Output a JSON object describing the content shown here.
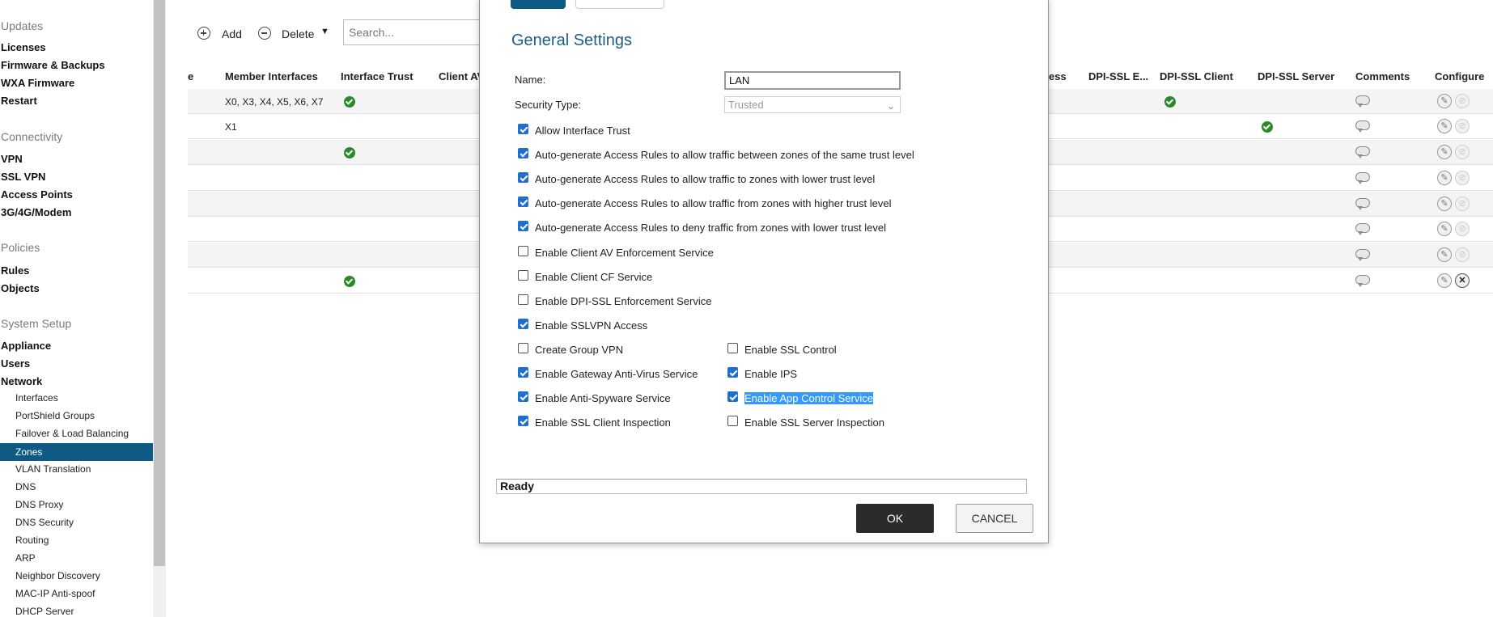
{
  "sidebar": {
    "sections": [
      {
        "heading": "Updates",
        "items": [
          "Licenses",
          "Firmware & Backups",
          "WXA Firmware",
          "Restart"
        ]
      },
      {
        "heading": "Connectivity",
        "items": [
          "VPN",
          "SSL VPN",
          "Access Points",
          "3G/4G/Modem"
        ]
      },
      {
        "heading": "Policies",
        "items": [
          "Rules",
          "Objects"
        ]
      },
      {
        "heading": "System Setup",
        "items": [
          "Appliance",
          "Users",
          "Network"
        ]
      }
    ],
    "network_subitems": [
      "Interfaces",
      "PortShield Groups",
      "Failover & Load Balancing",
      "Zones",
      "VLAN Translation",
      "DNS",
      "DNS Proxy",
      "DNS Security",
      "Routing",
      "ARP",
      "Neighbor Discovery",
      "MAC-IP Anti-spoof",
      "DHCP Server"
    ],
    "active_subitem": "Zones"
  },
  "toolbar": {
    "add_label": "Add",
    "delete_label": "Delete",
    "search_placeholder": "Search..."
  },
  "table": {
    "headers": {
      "name_partial": "e",
      "member_interfaces": "Member Interfaces",
      "interface_trust": "Interface Trust",
      "client_av": "Client AV",
      "ess_partial": "ess",
      "dpi_ssl_e": "DPI-SSL E...",
      "dpi_ssl_client": "DPI-SSL Client",
      "dpi_ssl_server": "DPI-SSL Server",
      "comments": "Comments",
      "configure": "Configure"
    },
    "rows": [
      {
        "members": "X0, X3, X4, X5, X6, X7",
        "trust": true,
        "dpi_client": true,
        "dpi_server": false,
        "deletable": false
      },
      {
        "members": "X1",
        "trust": false,
        "dpi_client": false,
        "dpi_server": true,
        "deletable": false
      },
      {
        "members": "",
        "trust": true,
        "dpi_client": false,
        "dpi_server": false,
        "deletable": false
      },
      {
        "members": "",
        "trust": false,
        "dpi_client": false,
        "dpi_server": false,
        "deletable": false
      },
      {
        "members": "",
        "trust": false,
        "dpi_client": false,
        "dpi_server": false,
        "deletable": false
      },
      {
        "members": "",
        "trust": false,
        "dpi_client": false,
        "dpi_server": false,
        "deletable": false
      },
      {
        "members": "",
        "trust": false,
        "dpi_client": false,
        "dpi_server": false,
        "deletable": false
      },
      {
        "members": "",
        "trust": true,
        "dpi_client": false,
        "dpi_server": false,
        "deletable": true
      }
    ]
  },
  "modal": {
    "title": "General Settings",
    "name_label": "Name:",
    "name_value": "LAN",
    "security_type_label": "Security Type:",
    "security_type_value": "Trusted",
    "checkboxes_full": [
      {
        "label": "Allow Interface Trust",
        "checked": true
      },
      {
        "label": "Auto-generate Access Rules to allow traffic between zones of the same trust level",
        "checked": true
      },
      {
        "label": "Auto-generate Access Rules to allow traffic to zones with lower trust level",
        "checked": true
      },
      {
        "label": "Auto-generate Access Rules to allow traffic from zones with higher trust level",
        "checked": true
      },
      {
        "label": "Auto-generate Access Rules to deny traffic from zones with lower trust level",
        "checked": true
      },
      {
        "label": "Enable Client AV Enforcement Service",
        "checked": false
      },
      {
        "label": "Enable Client CF Service",
        "checked": false
      },
      {
        "label": "Enable DPI-SSL Enforcement Service",
        "checked": false
      },
      {
        "label": "Enable SSLVPN Access",
        "checked": true
      }
    ],
    "checkboxes_left": [
      {
        "label": "Create Group VPN",
        "checked": false
      },
      {
        "label": "Enable Gateway Anti-Virus Service",
        "checked": true
      },
      {
        "label": "Enable Anti-Spyware Service",
        "checked": true
      },
      {
        "label": "Enable SSL Client Inspection",
        "checked": true
      }
    ],
    "checkboxes_right": [
      {
        "label": "Enable SSL Control",
        "checked": false
      },
      {
        "label": "Enable IPS",
        "checked": true
      },
      {
        "label": "Enable App Control Service",
        "checked": true,
        "highlighted": true
      },
      {
        "label": "Enable SSL Server Inspection",
        "checked": false
      }
    ],
    "status_text": "Ready",
    "ok_label": "OK",
    "cancel_label": "CANCEL"
  }
}
